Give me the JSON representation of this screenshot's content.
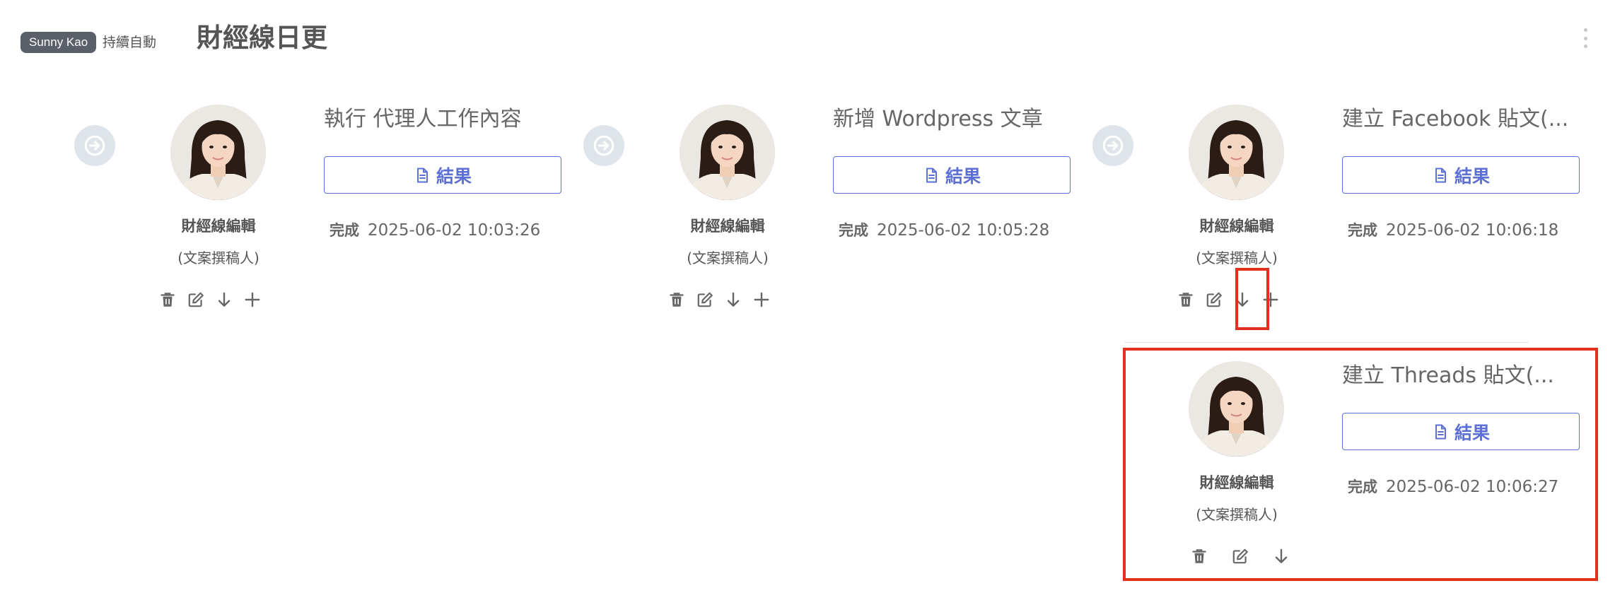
{
  "header": {
    "user_badge": "Sunny Kao",
    "tag": "持續自動",
    "title": "財經線日更"
  },
  "agent": {
    "name": "財經線編輯",
    "role": "(文案撰稿人)"
  },
  "result_label": "結果",
  "steps": [
    {
      "title": "執行 代理人工作內容",
      "status": "完成",
      "time": "2025-06-02 10:03:26"
    },
    {
      "title": "新增 Wordpress 文章",
      "status": "完成",
      "time": "2025-06-02 10:05:28"
    },
    {
      "title": "建立 Facebook 貼文(...",
      "status": "完成",
      "time": "2025-06-02 10:06:18"
    },
    {
      "title": "建立 Threads 貼文(...",
      "status": "完成",
      "time": "2025-06-02 10:06:27"
    }
  ],
  "icons": {
    "arrow": "arrow-right-circle-icon",
    "delete": "trash-icon",
    "edit": "edit-icon",
    "down": "arrow-down-icon",
    "add": "plus-icon",
    "file": "file-icon",
    "menu": "kebab-menu-icon"
  },
  "colors": {
    "accent": "#5b6fd6",
    "highlight": "#e3301d",
    "badge": "#5b5f69"
  }
}
